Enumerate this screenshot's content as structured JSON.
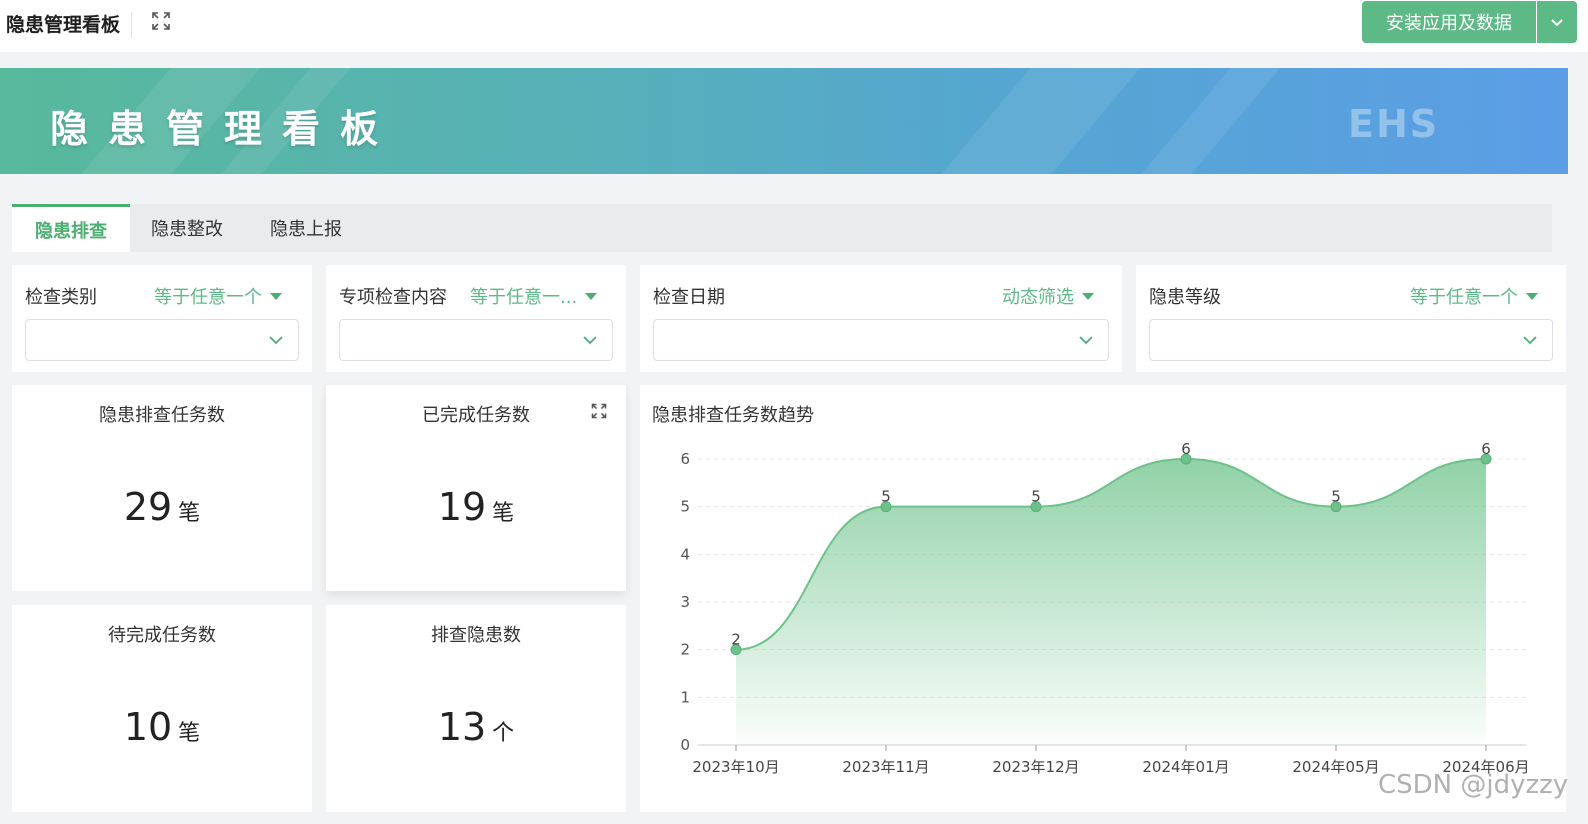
{
  "topbar": {
    "title": "隐患管理看板",
    "install_label": "安装应用及数据"
  },
  "banner": {
    "title": "隐患管理看板",
    "tag": "EHS"
  },
  "tabs": [
    {
      "label": "隐患排查",
      "active": true
    },
    {
      "label": "隐患整改",
      "active": false
    },
    {
      "label": "隐患上报",
      "active": false
    }
  ],
  "filters": [
    {
      "label": "检查类别",
      "operator": "等于任意一个",
      "value": ""
    },
    {
      "label": "专项检查内容",
      "operator": "等于任意一...",
      "value": ""
    },
    {
      "label": "检查日期",
      "operator": "动态筛选",
      "value": ""
    },
    {
      "label": "隐患等级",
      "operator": "等于任意一个",
      "value": ""
    }
  ],
  "kpis": [
    {
      "title": "隐患排查任务数",
      "value": "29",
      "unit": "笔"
    },
    {
      "title": "已完成任务数",
      "value": "19",
      "unit": "笔"
    },
    {
      "title": "待完成任务数",
      "value": "10",
      "unit": "笔"
    },
    {
      "title": "排查隐患数",
      "value": "13",
      "unit": "个"
    }
  ],
  "chart_data": {
    "type": "area",
    "title": "隐患排查任务数趋势",
    "categories": [
      "2023年10月",
      "2023年11月",
      "2023年12月",
      "2024年01月",
      "2024年05月",
      "2024年06月"
    ],
    "series": [
      {
        "values": [
          2,
          5,
          5,
          6,
          5,
          6
        ],
        "color": "#6cc28a"
      }
    ],
    "ylim": [
      0,
      6
    ],
    "yticks": [
      0,
      1,
      2,
      3,
      4,
      5,
      6
    ],
    "grid": true,
    "data_labels": true
  },
  "watermark": "CSDN @jdyzzy",
  "colors": {
    "accent": "#5dba86",
    "active_tab": "#4caf72",
    "series": "#6cc28a"
  }
}
